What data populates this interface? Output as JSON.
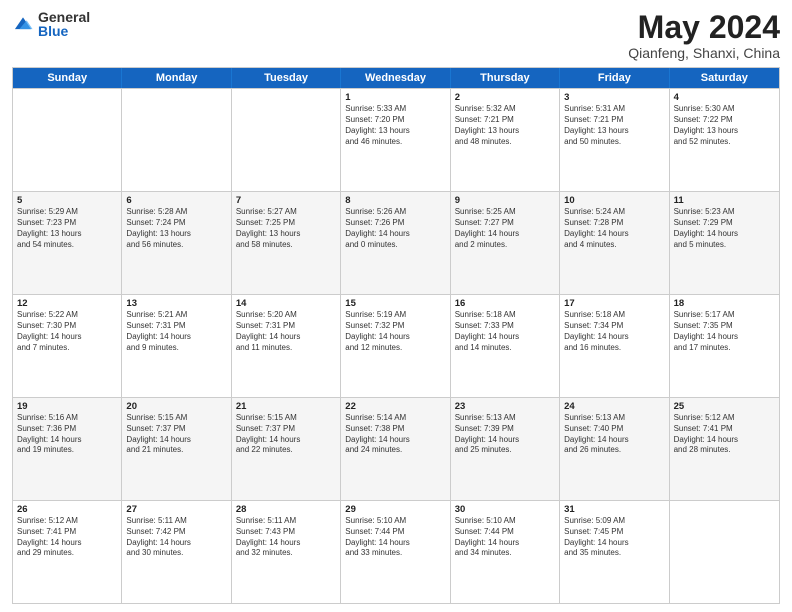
{
  "logo": {
    "general": "General",
    "blue": "Blue"
  },
  "title": {
    "month": "May 2024",
    "location": "Qianfeng, Shanxi, China"
  },
  "weekdays": [
    "Sunday",
    "Monday",
    "Tuesday",
    "Wednesday",
    "Thursday",
    "Friday",
    "Saturday"
  ],
  "rows": [
    [
      {
        "date": "",
        "info": ""
      },
      {
        "date": "",
        "info": ""
      },
      {
        "date": "",
        "info": ""
      },
      {
        "date": "1",
        "info": "Sunrise: 5:33 AM\nSunset: 7:20 PM\nDaylight: 13 hours\nand 46 minutes."
      },
      {
        "date": "2",
        "info": "Sunrise: 5:32 AM\nSunset: 7:21 PM\nDaylight: 13 hours\nand 48 minutes."
      },
      {
        "date": "3",
        "info": "Sunrise: 5:31 AM\nSunset: 7:21 PM\nDaylight: 13 hours\nand 50 minutes."
      },
      {
        "date": "4",
        "info": "Sunrise: 5:30 AM\nSunset: 7:22 PM\nDaylight: 13 hours\nand 52 minutes."
      }
    ],
    [
      {
        "date": "5",
        "info": "Sunrise: 5:29 AM\nSunset: 7:23 PM\nDaylight: 13 hours\nand 54 minutes."
      },
      {
        "date": "6",
        "info": "Sunrise: 5:28 AM\nSunset: 7:24 PM\nDaylight: 13 hours\nand 56 minutes."
      },
      {
        "date": "7",
        "info": "Sunrise: 5:27 AM\nSunset: 7:25 PM\nDaylight: 13 hours\nand 58 minutes."
      },
      {
        "date": "8",
        "info": "Sunrise: 5:26 AM\nSunset: 7:26 PM\nDaylight: 14 hours\nand 0 minutes."
      },
      {
        "date": "9",
        "info": "Sunrise: 5:25 AM\nSunset: 7:27 PM\nDaylight: 14 hours\nand 2 minutes."
      },
      {
        "date": "10",
        "info": "Sunrise: 5:24 AM\nSunset: 7:28 PM\nDaylight: 14 hours\nand 4 minutes."
      },
      {
        "date": "11",
        "info": "Sunrise: 5:23 AM\nSunset: 7:29 PM\nDaylight: 14 hours\nand 5 minutes."
      }
    ],
    [
      {
        "date": "12",
        "info": "Sunrise: 5:22 AM\nSunset: 7:30 PM\nDaylight: 14 hours\nand 7 minutes."
      },
      {
        "date": "13",
        "info": "Sunrise: 5:21 AM\nSunset: 7:31 PM\nDaylight: 14 hours\nand 9 minutes."
      },
      {
        "date": "14",
        "info": "Sunrise: 5:20 AM\nSunset: 7:31 PM\nDaylight: 14 hours\nand 11 minutes."
      },
      {
        "date": "15",
        "info": "Sunrise: 5:19 AM\nSunset: 7:32 PM\nDaylight: 14 hours\nand 12 minutes."
      },
      {
        "date": "16",
        "info": "Sunrise: 5:18 AM\nSunset: 7:33 PM\nDaylight: 14 hours\nand 14 minutes."
      },
      {
        "date": "17",
        "info": "Sunrise: 5:18 AM\nSunset: 7:34 PM\nDaylight: 14 hours\nand 16 minutes."
      },
      {
        "date": "18",
        "info": "Sunrise: 5:17 AM\nSunset: 7:35 PM\nDaylight: 14 hours\nand 17 minutes."
      }
    ],
    [
      {
        "date": "19",
        "info": "Sunrise: 5:16 AM\nSunset: 7:36 PM\nDaylight: 14 hours\nand 19 minutes."
      },
      {
        "date": "20",
        "info": "Sunrise: 5:15 AM\nSunset: 7:37 PM\nDaylight: 14 hours\nand 21 minutes."
      },
      {
        "date": "21",
        "info": "Sunrise: 5:15 AM\nSunset: 7:37 PM\nDaylight: 14 hours\nand 22 minutes."
      },
      {
        "date": "22",
        "info": "Sunrise: 5:14 AM\nSunset: 7:38 PM\nDaylight: 14 hours\nand 24 minutes."
      },
      {
        "date": "23",
        "info": "Sunrise: 5:13 AM\nSunset: 7:39 PM\nDaylight: 14 hours\nand 25 minutes."
      },
      {
        "date": "24",
        "info": "Sunrise: 5:13 AM\nSunset: 7:40 PM\nDaylight: 14 hours\nand 26 minutes."
      },
      {
        "date": "25",
        "info": "Sunrise: 5:12 AM\nSunset: 7:41 PM\nDaylight: 14 hours\nand 28 minutes."
      }
    ],
    [
      {
        "date": "26",
        "info": "Sunrise: 5:12 AM\nSunset: 7:41 PM\nDaylight: 14 hours\nand 29 minutes."
      },
      {
        "date": "27",
        "info": "Sunrise: 5:11 AM\nSunset: 7:42 PM\nDaylight: 14 hours\nand 30 minutes."
      },
      {
        "date": "28",
        "info": "Sunrise: 5:11 AM\nSunset: 7:43 PM\nDaylight: 14 hours\nand 32 minutes."
      },
      {
        "date": "29",
        "info": "Sunrise: 5:10 AM\nSunset: 7:44 PM\nDaylight: 14 hours\nand 33 minutes."
      },
      {
        "date": "30",
        "info": "Sunrise: 5:10 AM\nSunset: 7:44 PM\nDaylight: 14 hours\nand 34 minutes."
      },
      {
        "date": "31",
        "info": "Sunrise: 5:09 AM\nSunset: 7:45 PM\nDaylight: 14 hours\nand 35 minutes."
      },
      {
        "date": "",
        "info": ""
      }
    ]
  ]
}
